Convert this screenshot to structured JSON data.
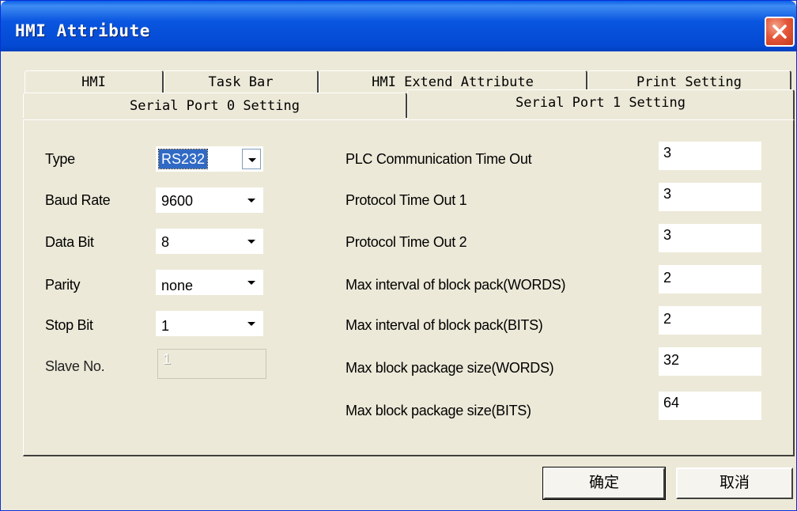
{
  "window": {
    "title": "HMI Attribute"
  },
  "tabs": {
    "row1": [
      "HMI",
      "Task Bar",
      "HMI Extend Attribute",
      "Print Setting"
    ],
    "row2": [
      "Serial Port 0 Setting",
      "Serial Port 1 Setting"
    ],
    "active": "Serial Port 1 Setting"
  },
  "left": {
    "type_label": "Type",
    "type_value": "RS232",
    "baud_label": "Baud Rate",
    "baud_value": "9600",
    "databit_label": "Data Bit",
    "databit_value": "8",
    "parity_label": "Parity",
    "parity_value": "none",
    "stopbit_label": "Stop Bit",
    "stopbit_value": "1",
    "slave_label": "Slave No.",
    "slave_value": "1"
  },
  "right": {
    "plc_timeout_label": "PLC Communication Time Out",
    "plc_timeout_value": "3",
    "proto1_label": "Protocol Time Out 1",
    "proto1_value": "3",
    "proto2_label": "Protocol Time Out 2",
    "proto2_value": "3",
    "max_int_words_label": "Max interval of block pack(WORDS)",
    "max_int_words_value": "2",
    "max_int_bits_label": "Max interval of block pack(BITS)",
    "max_int_bits_value": "2",
    "max_size_words_label": "Max block package size(WORDS)",
    "max_size_words_value": "32",
    "max_size_bits_label": "Max block package size(BITS)",
    "max_size_bits_value": "64"
  },
  "buttons": {
    "ok": "确定",
    "cancel": "取消"
  },
  "icons": {
    "close": "close-icon",
    "dropdown": "chevron-down-icon"
  },
  "colors": {
    "titlebar": "#0349d2",
    "close": "#e5573a",
    "selection": "#316ac5",
    "face": "#ece9d8"
  }
}
